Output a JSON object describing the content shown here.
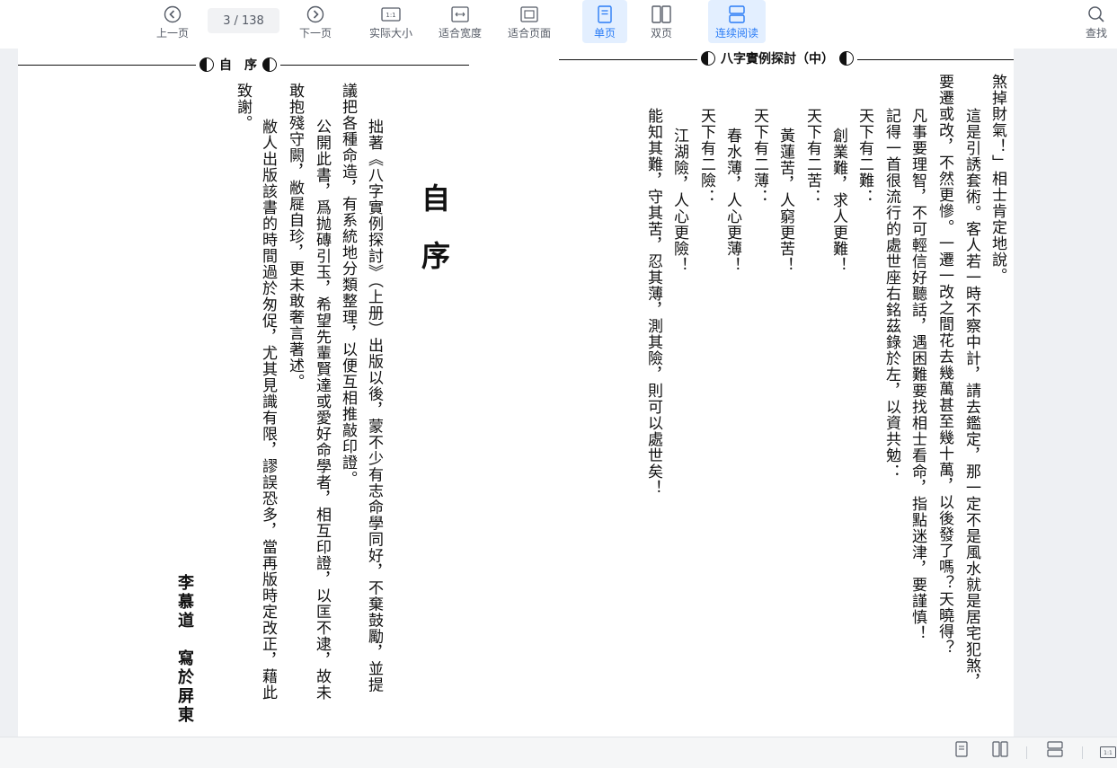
{
  "toolbar": {
    "prev_label": "上一页",
    "next_label": "下一页",
    "current_page": "3",
    "total_pages": "/ 138",
    "actual_size_label": "实际大小",
    "fit_width_label": "适合宽度",
    "fit_page_label": "适合页面",
    "single_label": "单页",
    "double_label": "双页",
    "continuous_label": "连续阅读",
    "search_label": "查找",
    "actual_size_icon_text": "1:1"
  },
  "colors": {
    "accent": "#2a7cf6",
    "active_bg": "#e3efff",
    "icon": "#555b66"
  },
  "left_page": {
    "header": "自　序",
    "title": "自序",
    "columns": [
      "拙著《八字實例探討》（上册）出版以後，蒙不少有志命學同好，不棄鼓勵，並提",
      "議把各種命造，有系統地分類整理，以便互相推敲印證。",
      "公開此書，爲抛磚引玉，希望先輩賢達或愛好命學者，相互印證，以匡不逮，故未",
      "敢抱殘守闕，敝屣自珍，更未敢奢言著述。",
      "敝人出版該書的時間過於匆促，尤其見識有限，謬誤恐多，當再版時定改正，藉此",
      "致謝。"
    ],
    "signature": "李慕道　寫於屏東"
  },
  "right_page": {
    "header": "八字實例探討（中）",
    "columns": [
      "煞掉財氣！」相士肯定地說。",
      "這是引誘套術。客人若一時不察中計，請去鑑定，那一定不是風水就是居宅犯煞，",
      "要遷或改，不然更慘。一遷一改之間花去幾萬甚至幾十萬，以後發了嗎？天曉得？",
      "凡事要理智，不可輕信好聽話，遇困難要找相士看命，指點迷津，要謹慎！",
      "記得一首很流行的處世座右銘茲錄於左，以資共勉：",
      "天下有二難：",
      "創業難，求人更難！",
      "天下有二苦：",
      "黃蓮苦，人窮更苦！",
      "天下有二薄：",
      "春水薄，人心更薄！",
      "天下有二險：",
      "江湖險，人心更險！",
      "能知其難，守其苦，忍其薄，測其險，則可以處世矣！"
    ]
  },
  "statusbar": {
    "actual_size_icon_text": "1:1"
  }
}
